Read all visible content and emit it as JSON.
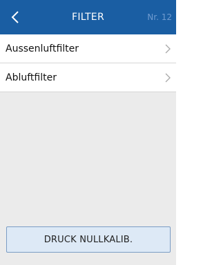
{
  "header": {
    "back_icon": "chevron-left-icon",
    "title": "FILTER",
    "screen_number": "Nr. 12",
    "background_color": "#1a5ea3"
  },
  "menu": {
    "items": [
      {
        "label": "Aussenluftfilter",
        "icon": "chevron-right-icon"
      },
      {
        "label": "Abluftfilter",
        "icon": "chevron-right-icon"
      }
    ]
  },
  "footer": {
    "button_label": "DRUCK NULLKALIB."
  }
}
